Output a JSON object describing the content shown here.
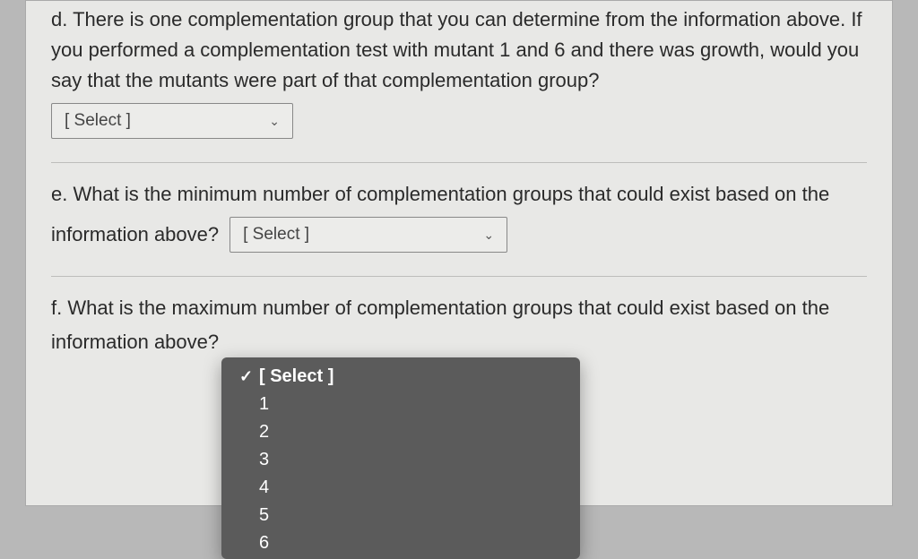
{
  "questions": {
    "d": {
      "text": "d. There is one complementation group that you can determine from the information above. If you performed a complementation test with mutant 1 and 6 and there was growth, would you say that the mutants were part of that complementation group?",
      "select_placeholder": "[ Select ]"
    },
    "e": {
      "text_before": "e. What is the minimum number of complementation groups that could exist based on the",
      "text_after": "information above?",
      "select_placeholder": "[ Select ]"
    },
    "f": {
      "text_before": "f. What is the maximum number of complementation groups that could exist based on the",
      "text_after": "information above?",
      "select_placeholder": "[ Select ]"
    }
  },
  "dropdown": {
    "selected": "[ Select ]",
    "options": [
      "1",
      "2",
      "3",
      "4",
      "5",
      "6"
    ]
  },
  "icons": {
    "chevron": "⌄",
    "check": "✓"
  }
}
